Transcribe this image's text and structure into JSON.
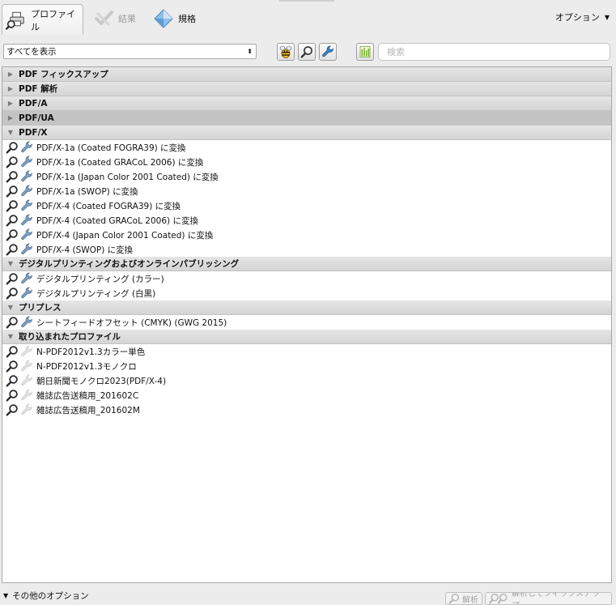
{
  "tabs": [
    {
      "id": "profiles",
      "label": "プロファイル",
      "icon": "printer-magnifier-icon",
      "active": true,
      "disabled": false
    },
    {
      "id": "results",
      "label": "結果",
      "icon": "check-icon",
      "active": false,
      "disabled": true
    },
    {
      "id": "standards",
      "label": "規格",
      "icon": "diamond-icon",
      "active": false,
      "disabled": false
    }
  ],
  "options_menu": {
    "label": "オプション"
  },
  "toolbar": {
    "filter_value": "すべてを表示",
    "search_placeholder": "検索"
  },
  "groups": [
    {
      "label": "PDF フィックスアップ",
      "expanded": false,
      "selected": false,
      "items": []
    },
    {
      "label": "PDF 解析",
      "expanded": false,
      "selected": false,
      "items": []
    },
    {
      "label": "PDF/A",
      "expanded": false,
      "selected": false,
      "items": []
    },
    {
      "label": "PDF/UA",
      "expanded": false,
      "selected": true,
      "items": []
    },
    {
      "label": "PDF/X",
      "expanded": true,
      "selected": false,
      "items": [
        {
          "label": "PDF/X-1a (Coated FOGRA39) に変換",
          "fixup": true
        },
        {
          "label": "PDF/X-1a (Coated GRACoL 2006) に変換",
          "fixup": true
        },
        {
          "label": "PDF/X-1a (Japan Color 2001 Coated) に変換",
          "fixup": true
        },
        {
          "label": "PDF/X-1a (SWOP) に変換",
          "fixup": true
        },
        {
          "label": "PDF/X-4 (Coated FOGRA39) に変換",
          "fixup": true
        },
        {
          "label": "PDF/X-4 (Coated GRACoL 2006) に変換",
          "fixup": true
        },
        {
          "label": "PDF/X-4 (Japan Color 2001 Coated) に変換",
          "fixup": true
        },
        {
          "label": "PDF/X-4 (SWOP) に変換",
          "fixup": true
        }
      ]
    },
    {
      "label": "デジタルプリンティングおよびオンラインパブリッシング",
      "expanded": true,
      "selected": false,
      "items": [
        {
          "label": "デジタルプリンティング (カラー)",
          "fixup": true
        },
        {
          "label": "デジタルプリンティング (白黒)",
          "fixup": true
        }
      ]
    },
    {
      "label": "プリプレス",
      "expanded": true,
      "selected": false,
      "items": [
        {
          "label": "シートフィードオフセット (CMYK) (GWG 2015)",
          "fixup": true
        }
      ]
    },
    {
      "label": "取り込まれたプロファイル",
      "expanded": true,
      "selected": false,
      "items": [
        {
          "label": "N-PDF2012v1.3カラー単色",
          "fixup": false
        },
        {
          "label": "N-PDF2012v1.3モノクロ",
          "fixup": false
        },
        {
          "label": "朝日新聞モノクロ2023(PDF/X-4)",
          "fixup": false
        },
        {
          "label": "雑誌広告送稿用_201602C",
          "fixup": false
        },
        {
          "label": "雑誌広告送稿用_201602M",
          "fixup": false
        }
      ]
    }
  ],
  "bottom": {
    "more_options_label": "その他のオプション",
    "analyze_label": "解析",
    "analyze_fix_label": "解析してフィックスアップ"
  }
}
